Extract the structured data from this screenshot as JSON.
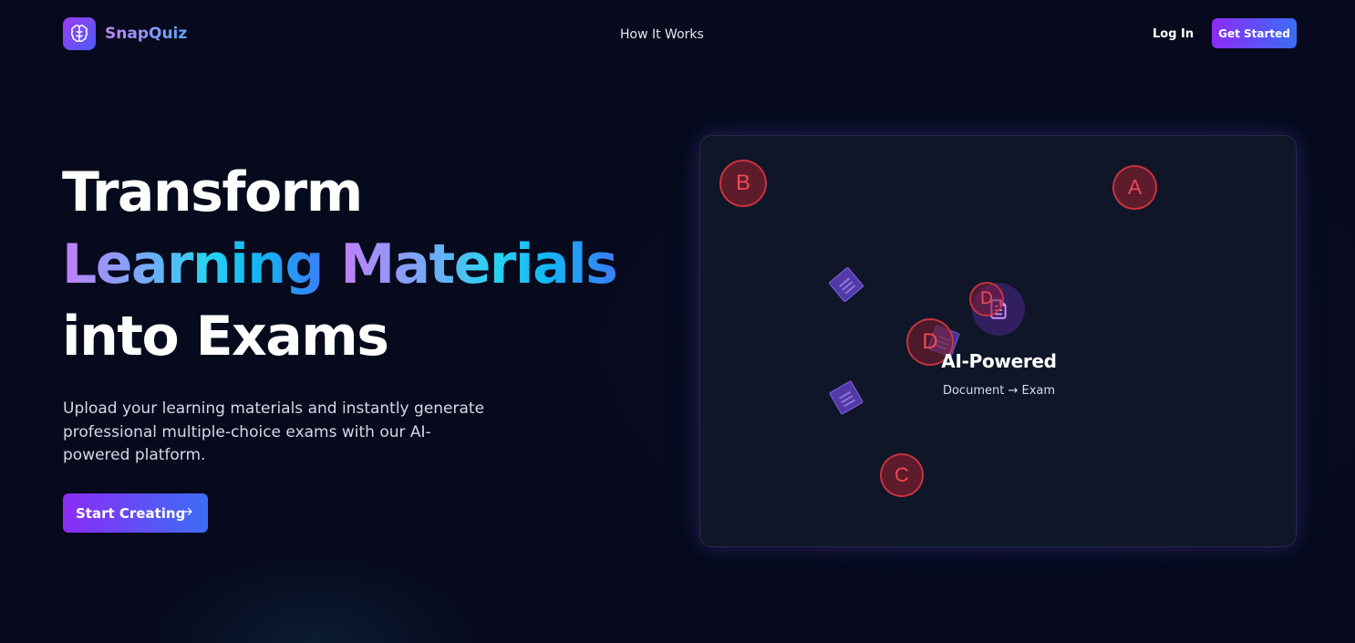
{
  "nav": {
    "brand": "SnapQuiz",
    "how_it_works": "How It Works",
    "login": "Log In",
    "get_started": "Get Started"
  },
  "hero": {
    "line1": "Transform",
    "line2a": "Learning",
    "line2b": "Materials",
    "line3": "into Exams",
    "description": "Upload your learning materials and instantly generate professional multiple-choice exams with our AI-powered platform.",
    "cta": "Start Creating"
  },
  "panel": {
    "title": "AI-Powered",
    "subtitle": "Document → Exam",
    "bubbles": [
      "B",
      "A",
      "D",
      "D",
      "C"
    ]
  },
  "colors": {
    "background": "#070a1c",
    "accent_purple": "#8b2cf5",
    "accent_blue": "#3b6df6",
    "bubble_red": "#ef4a54",
    "panel_bg": "#0e1628"
  },
  "icons": {
    "logo": "brain-icon",
    "cta": "arrow-right-icon",
    "center": "document-text-icon"
  }
}
